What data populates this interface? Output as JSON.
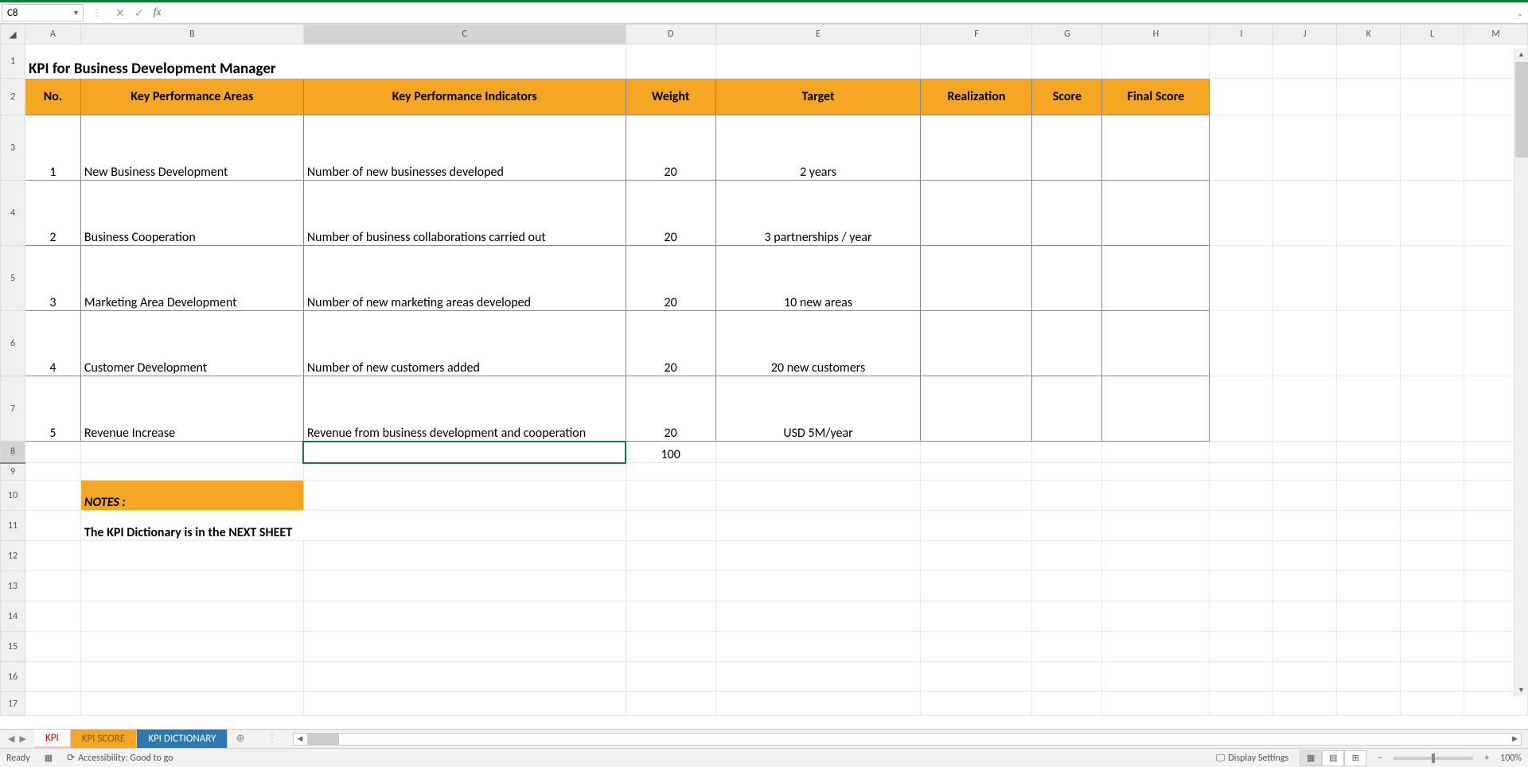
{
  "formula_bar": {
    "cell_ref": "C8",
    "cancel": "✕",
    "confirm": "✓",
    "fx": "fx",
    "value": ""
  },
  "columns": {
    "A": "A",
    "B": "B",
    "C": "C",
    "D": "D",
    "E": "E",
    "F": "F",
    "G": "G",
    "H": "H",
    "I": "I",
    "J": "J",
    "K": "K",
    "L": "L",
    "M": "M"
  },
  "rows": {
    "1": "1",
    "2": "2",
    "3": "3",
    "4": "4",
    "5": "5",
    "6": "6",
    "7": "7",
    "8": "8",
    "9": "9",
    "10": "10",
    "11": "11",
    "12": "12",
    "13": "13",
    "14": "14",
    "15": "15",
    "16": "16",
    "17": "17"
  },
  "title": "KPI for Business Development Manager",
  "headers": {
    "no": "No.",
    "kpa": "Key Performance Areas",
    "kpi": "Key Performance Indicators",
    "weight": "Weight",
    "target": "Target",
    "realization": "Realization",
    "score": "Score",
    "final": "Final Score"
  },
  "data": [
    {
      "no": "1",
      "kpa": "New Business Development",
      "kpi": "Number of new businesses developed",
      "weight": "20",
      "target": "2 years"
    },
    {
      "no": "2",
      "kpa": "Business Cooperation",
      "kpi": "Number of business collaborations carried out",
      "weight": "20",
      "target": "3 partnerships / year"
    },
    {
      "no": "3",
      "kpa": "Marketing Area Development",
      "kpi": "Number of new marketing areas developed",
      "weight": "20",
      "target": "10 new areas"
    },
    {
      "no": "4",
      "kpa": "Customer Development",
      "kpi": "Number of new customers added",
      "weight": "20",
      "target": "20 new customers"
    },
    {
      "no": "5",
      "kpa": "Revenue Increase",
      "kpi": "Revenue from business development and cooperation",
      "weight": "20",
      "target": "USD 5M/year"
    }
  ],
  "total_weight": "100",
  "notes_label": "NOTES :",
  "notes_text": "The KPI Dictionary is in the NEXT SHEET",
  "tabs": {
    "kpi": "KPI",
    "score": "KPI SCORE",
    "dict": "KPI DICTIONARY"
  },
  "status": {
    "ready": "Ready",
    "accessibility": "Accessibility: Good to go",
    "display_settings": "Display Settings",
    "zoom": "100%",
    "minus": "−",
    "plus": "+"
  }
}
